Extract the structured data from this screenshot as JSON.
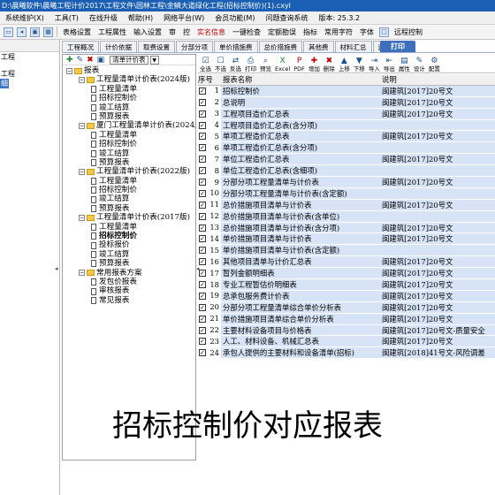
{
  "window": {
    "title": "D:\\晨曦软件\\晨曦工程计价2017\\工程文件\\园林工程\\金鳞大道绿化工程(招标控制价)(1).cxyl"
  },
  "menu": [
    "系统维护(X)",
    "工具(T)",
    "在线升级",
    "帮助(H)",
    "网络平台(W)",
    "会员功能(M)",
    "问题查询系统",
    "版本: 25.3.2"
  ],
  "toolbar": {
    "items": [
      "表格设置",
      "工程属性",
      "输入设置",
      "审",
      "控",
      "实名信息",
      "一键检查",
      "定额勘误",
      "指标",
      "常用字符",
      "字体",
      "远程控制"
    ]
  },
  "left_pane": {
    "items": [
      "工程",
      "工程",
      "细"
    ]
  },
  "tabs": [
    "工程概况",
    "计价依据",
    "取费设置",
    "分部分项",
    "单价措施费",
    "总价措施费",
    "其他费",
    "材料汇总",
    "造价汇总",
    "打印"
  ],
  "tree_tool": {
    "combo": "清单计价表"
  },
  "tree": [
    {
      "level": 0,
      "type": "folder",
      "label": "报表"
    },
    {
      "level": 1,
      "type": "folder",
      "label": "工程量清单计价表(2024版)"
    },
    {
      "level": 2,
      "type": "doc",
      "label": "工程量清单"
    },
    {
      "level": 2,
      "type": "doc",
      "label": "招标控制价"
    },
    {
      "level": 2,
      "type": "doc",
      "label": "竣工结算"
    },
    {
      "level": 2,
      "type": "doc",
      "label": "预算报表"
    },
    {
      "level": 1,
      "type": "folder",
      "label": "厦门工程量清单计价表(2024版)"
    },
    {
      "level": 2,
      "type": "doc",
      "label": "工程量清单"
    },
    {
      "level": 2,
      "type": "doc",
      "label": "招标控制价"
    },
    {
      "level": 2,
      "type": "doc",
      "label": "竣工结算"
    },
    {
      "level": 2,
      "type": "doc",
      "label": "预算报表"
    },
    {
      "level": 1,
      "type": "folder",
      "label": "工程量清单计价表(2022版)"
    },
    {
      "level": 2,
      "type": "doc",
      "label": "工程量清单"
    },
    {
      "level": 2,
      "type": "doc",
      "label": "招标控制价"
    },
    {
      "level": 2,
      "type": "doc",
      "label": "竣工结算"
    },
    {
      "level": 2,
      "type": "doc",
      "label": "预算报表"
    },
    {
      "level": 1,
      "type": "folder",
      "label": "工程量清单计价表(2017版)"
    },
    {
      "level": 2,
      "type": "doc",
      "label": "工程量清单"
    },
    {
      "level": 2,
      "type": "doc",
      "label": "招标控制价",
      "selected": true
    },
    {
      "level": 2,
      "type": "doc",
      "label": "投标报价"
    },
    {
      "level": 2,
      "type": "doc",
      "label": "竣工结算"
    },
    {
      "level": 2,
      "type": "doc",
      "label": "预算报表"
    },
    {
      "level": 1,
      "type": "folder",
      "label": "常用报表方案"
    },
    {
      "level": 2,
      "type": "doc",
      "label": "发包价报表"
    },
    {
      "level": 2,
      "type": "doc",
      "label": "审核报表"
    },
    {
      "level": 2,
      "type": "doc",
      "label": "常见报表"
    }
  ],
  "print_tab": {
    "label": "打印"
  },
  "print_toolbar": [
    {
      "icon": "☑",
      "label": "全选",
      "color": ""
    },
    {
      "icon": "☐",
      "label": "不选",
      "color": ""
    },
    {
      "icon": "⇄",
      "label": "反选",
      "color": ""
    },
    {
      "icon": "⎙",
      "label": "打印",
      "color": ""
    },
    {
      "icon": "⌕",
      "label": "预览",
      "color": ""
    },
    {
      "icon": "X",
      "label": "Excel",
      "color": "grn"
    },
    {
      "icon": "P",
      "label": "PDF",
      "color": "red"
    },
    {
      "icon": "✚",
      "label": "增加",
      "color": "red"
    },
    {
      "icon": "✖",
      "label": "删除",
      "color": "red"
    },
    {
      "icon": "▲",
      "label": "上移",
      "color": ""
    },
    {
      "icon": "▼",
      "label": "下移",
      "color": ""
    },
    {
      "icon": "⇥",
      "label": "导入",
      "color": ""
    },
    {
      "icon": "⇤",
      "label": "导出",
      "color": ""
    },
    {
      "icon": "▤",
      "label": "属性",
      "color": ""
    },
    {
      "icon": "✎",
      "label": "设计",
      "color": ""
    },
    {
      "icon": "⚙",
      "label": "配置",
      "color": ""
    }
  ],
  "grid": {
    "headers": {
      "seq": "序号",
      "name": "报表名称",
      "desc": "说明"
    },
    "rows": [
      {
        "n": "1",
        "name": "招标控制价",
        "desc": "闽建筑[2017]20号文"
      },
      {
        "n": "2",
        "name": "总说明",
        "desc": "闽建筑[2017]20号文"
      },
      {
        "n": "3",
        "name": "工程项目造价汇总表",
        "desc": "闽建筑[2017]20号文"
      },
      {
        "n": "4",
        "name": "工程项目造价汇总表(含分项)",
        "desc": ""
      },
      {
        "n": "5",
        "name": "单项工程造价汇总表",
        "desc": "闽建筑[2017]20号文"
      },
      {
        "n": "6",
        "name": "单项工程造价汇总表(含分项)",
        "desc": ""
      },
      {
        "n": "7",
        "name": "单位工程造价汇总表",
        "desc": "闽建筑[2017]20号文"
      },
      {
        "n": "8",
        "name": "单位工程造价汇总表(含细项)",
        "desc": ""
      },
      {
        "n": "9",
        "name": "分部分项工程量清单与计价表",
        "desc": "闽建筑[2017]20号文"
      },
      {
        "n": "10",
        "name": "分部分项工程量清单与计价表(含定额)",
        "desc": ""
      },
      {
        "n": "11",
        "name": "总价措施项目清单与计价表",
        "desc": "闽建筑[2017]20号文"
      },
      {
        "n": "12",
        "name": "总价措施项目清单与计价表(含单位)",
        "desc": ""
      },
      {
        "n": "13",
        "name": "总价措施项目清单与计价表(含分项)",
        "desc": "闽建筑[2017]20号文"
      },
      {
        "n": "14",
        "name": "单价措施项目清单与计价表",
        "desc": "闽建筑[2017]20号文"
      },
      {
        "n": "15",
        "name": "单价措施项目清单与计价表(含定额)",
        "desc": ""
      },
      {
        "n": "16",
        "name": "其他项目清单与计价汇总表",
        "desc": "闽建筑[2017]20号文"
      },
      {
        "n": "17",
        "name": "暂列金额明细表",
        "desc": "闽建筑[2017]20号文"
      },
      {
        "n": "18",
        "name": "专业工程暂估价明细表",
        "desc": "闽建筑[2017]20号文"
      },
      {
        "n": "19",
        "name": "总承包服务费计价表",
        "desc": "闽建筑[2017]20号文"
      },
      {
        "n": "20",
        "name": "分部分项工程量清单综合单价分析表",
        "desc": "闽建筑[2017]20号文"
      },
      {
        "n": "21",
        "name": "单价措施项目清单综合单价分析表",
        "desc": "闽建筑[2017]20号文"
      },
      {
        "n": "22",
        "name": "主要材料设备项目与价格表",
        "desc": "闽建筑[2017]20号文-质量安全"
      },
      {
        "n": "23",
        "name": "人工、材料设备、机械汇总表",
        "desc": "闽建筑[2017]20号文"
      },
      {
        "n": "24",
        "name": "承包人提供的主要材料和设备清单(招标)",
        "desc": "闽建筑[2018]41号文-风险调差"
      }
    ]
  },
  "caption": "招标控制价对应报表"
}
